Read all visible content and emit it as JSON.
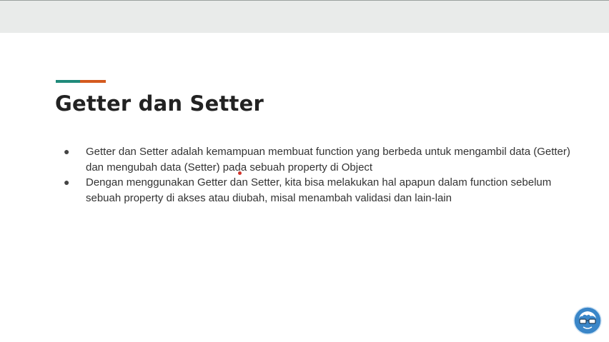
{
  "slide": {
    "title": "Getter dan Setter",
    "bullets": [
      "Getter dan Setter adalah kemampuan membuat function yang berbeda untuk mengambil data (Getter) dan mengubah data (Setter) pada sebuah property di Object",
      "Dengan menggunakan Getter dan Setter, kita bisa melakukan hal apapun dalam function sebelum sebuah property di akses atau diubah, misal menambah validasi dan lain-lain"
    ],
    "bullet_glyph": "●"
  },
  "colors": {
    "accent_teal": "#1f8a7a",
    "accent_orange": "#d45a1e",
    "pointer": "#d1342c",
    "logo_blue": "#3a86c8"
  },
  "icons": {
    "logo": "avatar-with-glasses-icon",
    "pointer": "laser-pointer-dot"
  }
}
